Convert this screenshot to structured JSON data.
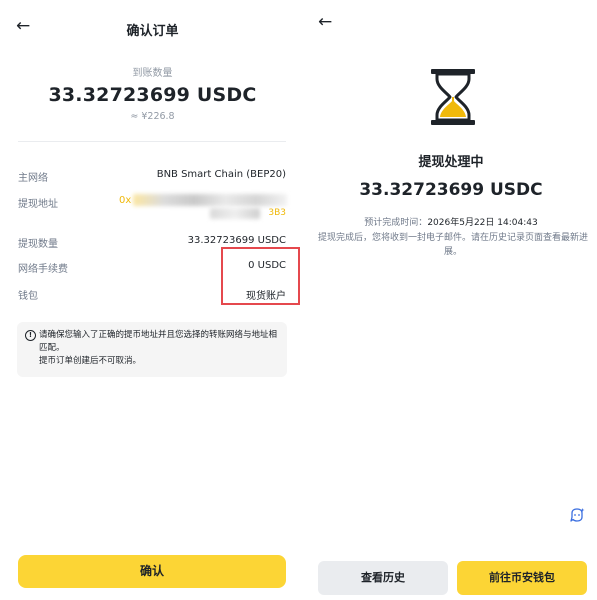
{
  "left": {
    "back_icon": "←",
    "title": "确认订单",
    "amount_label": "到账数量",
    "amount": "33.32723699 USDC",
    "amount_approx": "≈ ¥226.8",
    "rows": {
      "network_label": "主网络",
      "network_value": "BNB Smart Chain (BEP20)",
      "address_label": "提现地址",
      "address_start": "0x",
      "address_end": "3B3",
      "qty_label": "提现数量",
      "qty_value": "33.32723699 USDC",
      "fee_label": "网络手续费",
      "fee_value": "0 USDC",
      "wallet_label": "钱包",
      "wallet_value": "现货账户"
    },
    "notice_icon": "!",
    "notice_text_1": "请确保您输入了正确的提币地址并且您选择的转账网络与地址相匹配。",
    "notice_text_2": "提币订单创建后不可取消。",
    "confirm_button": "确认",
    "highlight_color": "#e5484d",
    "accent_color": "#fcd535"
  },
  "right": {
    "back_icon": "←",
    "status_title": "提现处理中",
    "amount": "33.32723699 USDC",
    "eta_label": "预计完成时间：",
    "eta_value": "2026年5月22日 14:04:43",
    "description": "提现完成后，您将收到一封电子邮件。请在历史记录页面查看最新进展。",
    "history_button": "查看历史",
    "wallet_button": "前往币安钱包",
    "icons": [
      "hourglass-icon",
      "assistant-icon"
    ]
  }
}
